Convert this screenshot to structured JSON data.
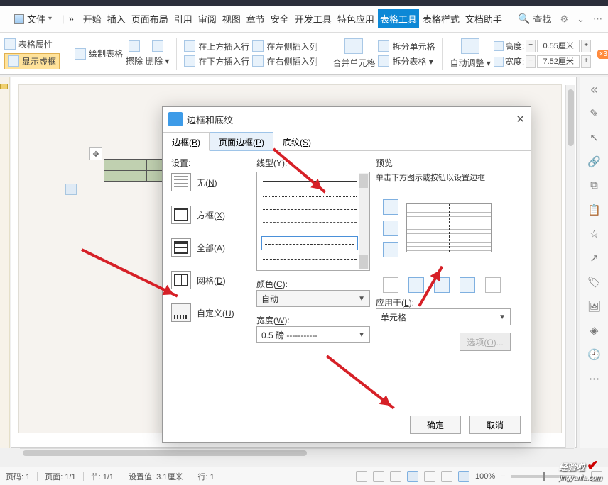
{
  "menu": {
    "file": "文件",
    "tabs": [
      "开始",
      "插入",
      "页面布局",
      "引用",
      "审阅",
      "视图",
      "章节",
      "安全",
      "开发工具",
      "特色应用",
      "表格工具",
      "表格样式",
      "文档助手"
    ],
    "active_index": 10,
    "search": "查找",
    "more": "»"
  },
  "ribbon": {
    "table_props": "表格属性",
    "show_vb": "显示虚框",
    "draw": "绘制表格",
    "erase": "擦除",
    "delete": "删除",
    "ins_above": "在上方插入行",
    "ins_below": "在下方插入行",
    "ins_left": "在左侧插入列",
    "ins_right": "在右侧插入列",
    "merge": "合并单元格",
    "split_cell": "拆分单元格",
    "split_table": "拆分表格",
    "autofit": "自动调整",
    "height_lbl": "高度:",
    "width_lbl": "宽度:",
    "height_val": "0.55厘米",
    "width_val": "7.52厘米",
    "corner": "×3"
  },
  "dialog": {
    "title": "边框和底纹",
    "tabs": {
      "border": "边框(B)",
      "page_border": "页面边框(P)",
      "shading": "底纹(S)"
    },
    "setting_lbl": "设置:",
    "settings": {
      "none": "无(N)",
      "box": "方框(X)",
      "all": "全部(A)",
      "grid": "网格(D)",
      "custom": "自定义(U)"
    },
    "line_lbl": "线型(Y):",
    "color_lbl": "颜色(C):",
    "color_val": "自动",
    "width_lbl": "宽度(W):",
    "width_val": "0.5  磅",
    "preview_lbl": "预览",
    "preview_hint": "单击下方图示或按钮以设置边框",
    "apply_lbl": "应用于(L):",
    "apply_val": "单元格",
    "options": "选项(O)...",
    "ok": "确定",
    "cancel": "取消"
  },
  "status": {
    "page_no": "页码: 1",
    "page": "页面: 1/1",
    "section": "节: 1/1",
    "set_val": "设置值: 3.1厘米",
    "row": "行: 1",
    "zoom": "100%"
  },
  "watermark": {
    "line1": "经验啦",
    "line2": "jingyanla.com"
  }
}
